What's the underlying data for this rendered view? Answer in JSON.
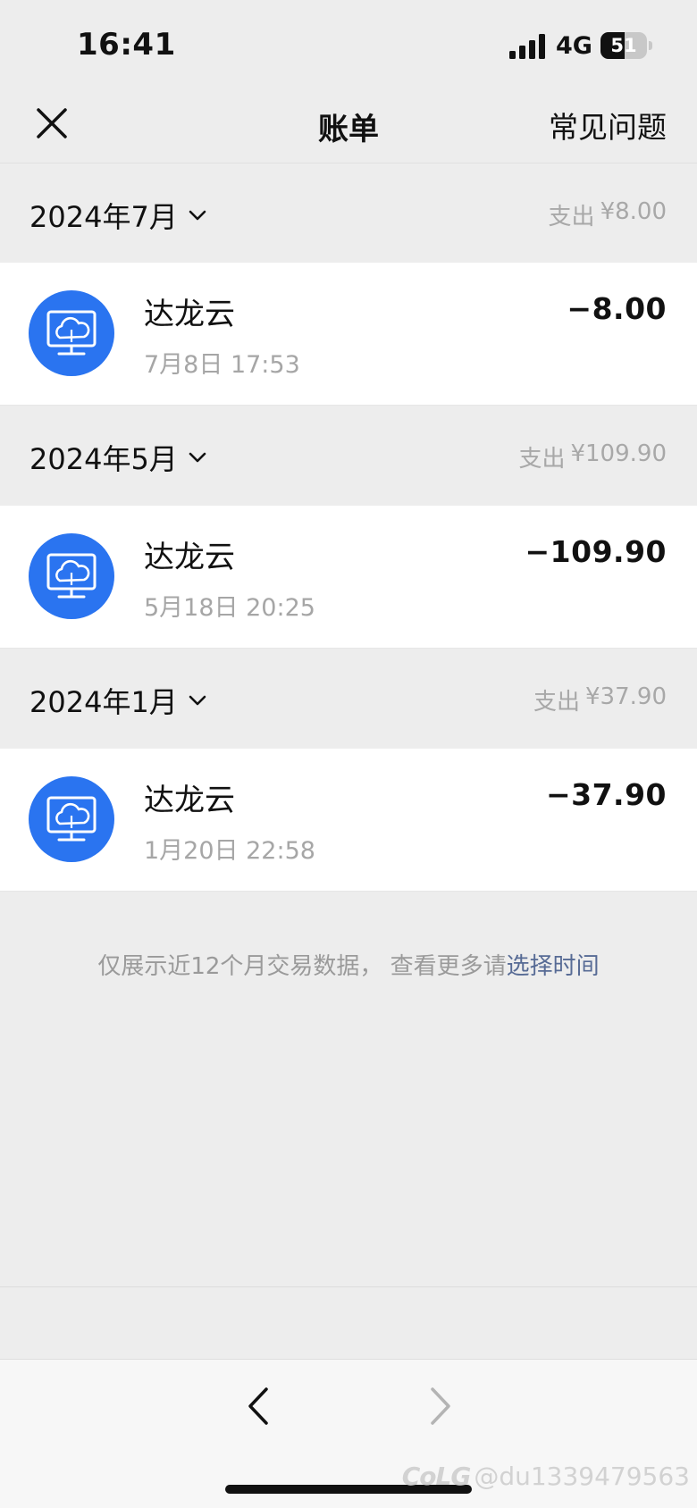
{
  "status_bar": {
    "time": "16:41",
    "network": "4G",
    "battery_level": "51",
    "icons": [
      "signal-icon",
      "battery-icon"
    ]
  },
  "nav": {
    "title": "账单",
    "faq": "常见问题",
    "icons": [
      "close-icon"
    ]
  },
  "months": [
    {
      "label": "2024年7月",
      "total_label": "支出",
      "total_amount": "¥8.00",
      "transactions": [
        {
          "merchant": "达龙云",
          "time": "7月8日 17:53",
          "amount": "−8.00",
          "icon": "cloud-monitor-icon"
        }
      ]
    },
    {
      "label": "2024年5月",
      "total_label": "支出",
      "total_amount": "¥109.90",
      "transactions": [
        {
          "merchant": "达龙云",
          "time": "5月18日 20:25",
          "amount": "−109.90",
          "icon": "cloud-monitor-icon"
        }
      ]
    },
    {
      "label": "2024年1月",
      "total_label": "支出",
      "total_amount": "¥37.90",
      "transactions": [
        {
          "merchant": "达龙云",
          "time": "1月20日 22:58",
          "amount": "−37.90",
          "icon": "cloud-monitor-icon"
        }
      ]
    }
  ],
  "footer": {
    "note": "仅展示近12个月交易数据， 查看更多请",
    "link": "选择时间"
  },
  "toolbar": {
    "icons": [
      "back-arrow-icon",
      "forward-arrow-icon"
    ]
  },
  "watermark": {
    "logo": "CoLG",
    "handle": "@du1339479563"
  },
  "colors": {
    "background": "#ededed",
    "card": "#ffffff",
    "avatar": "#2a74f0",
    "link": "#576b95",
    "muted": "#a8a8a8"
  }
}
